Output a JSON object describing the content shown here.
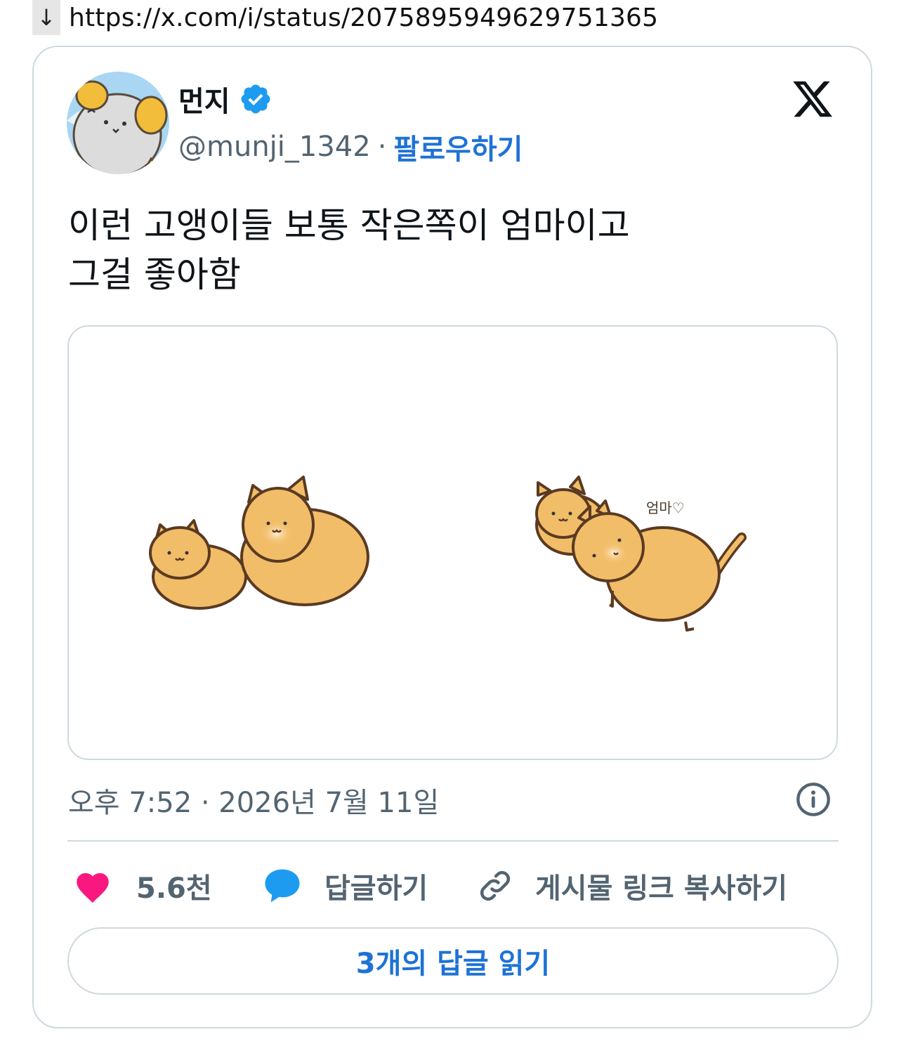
{
  "browser": {
    "arrow": "↓",
    "url": "https://x.com/i/status/2075895949629751365"
  },
  "tweet": {
    "author": {
      "name": "먼지",
      "handle": "@munji_1342",
      "separator": "·",
      "follow_label": "팔로우하기",
      "verified": true
    },
    "text_line1": "이런 고앵이들 보통 작은쪽이 엄마이고",
    "text_line2": "그걸 좋아함",
    "media": {
      "handwritten_label": "엄마♡"
    },
    "timestamp": "오후 7:52 · 2026년 7월 11일",
    "actions": {
      "like_count": "5.6천",
      "reply_label": "답글하기",
      "copy_link_label": "게시물 링크 복사하기"
    },
    "read_replies_label": "3개의 답글 읽기"
  },
  "colors": {
    "accent": "#1d72d6",
    "verified": "#1d9bf0",
    "like": "#f91880",
    "cat_fill": "#f2bd68",
    "cat_outline": "#5a3a22",
    "border": "#cfd9de"
  },
  "icons": [
    "down-arrow-icon",
    "verified-badge-icon",
    "x-logo-icon",
    "info-icon",
    "heart-icon",
    "reply-bubble-icon",
    "link-icon"
  ]
}
